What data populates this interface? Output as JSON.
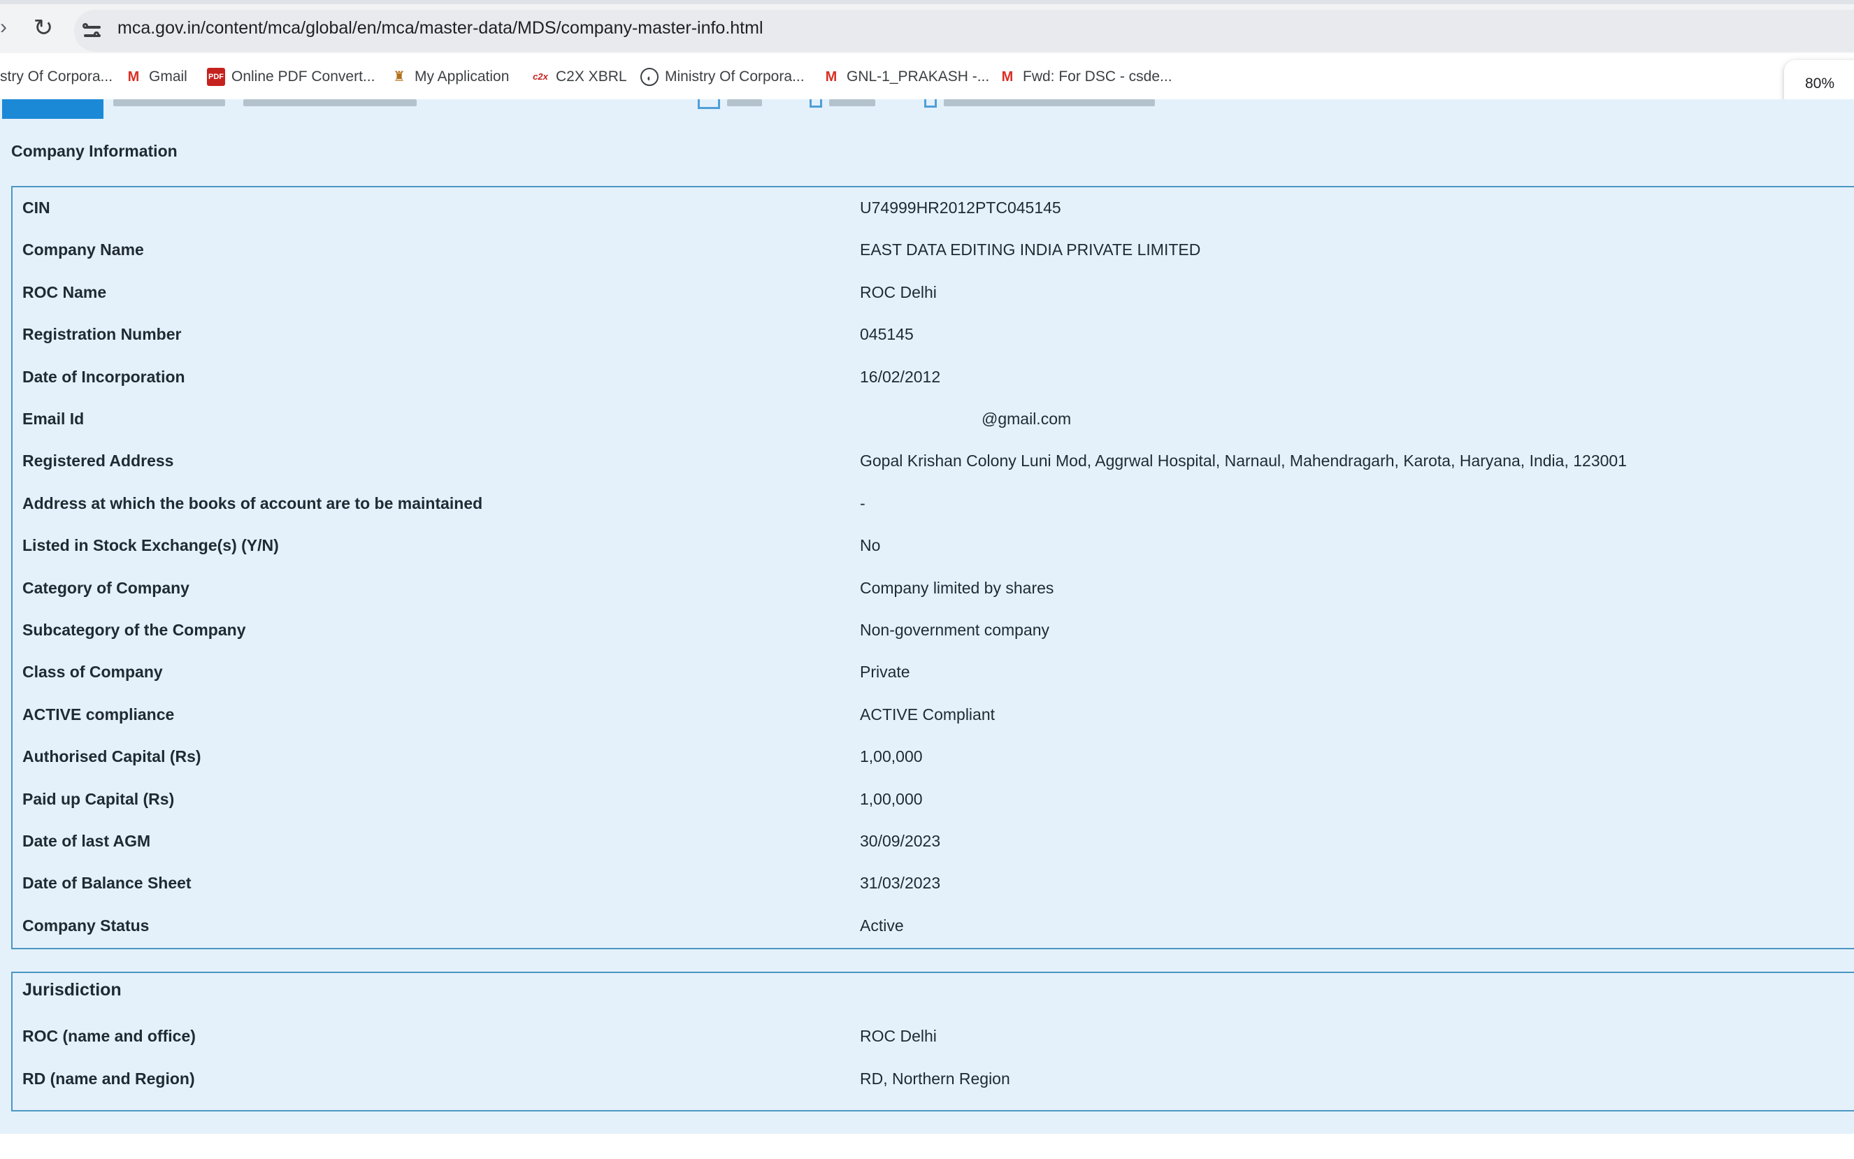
{
  "browser": {
    "url": "mca.gov.in/content/mca/global/en/mca/master-data/MDS/company-master-info.html",
    "zoom": "80%",
    "bookmarks": [
      {
        "label": "stry Of Corpora...",
        "icon": ""
      },
      {
        "label": "Gmail",
        "icon": "gmail-icon"
      },
      {
        "label": "Online PDF Convert...",
        "icon": "pdf-icon"
      },
      {
        "label": "My Application",
        "icon": "application-icon"
      },
      {
        "label": "C2X XBRL",
        "icon": "c2x-icon"
      },
      {
        "label": "Ministry Of Corpora...",
        "icon": "globe-icon"
      },
      {
        "label": "GNL-1_PRAKASH -...",
        "icon": "gmail-icon"
      },
      {
        "label": "Fwd: For DSC - csde...",
        "icon": "gmail-icon"
      }
    ]
  },
  "company_info": {
    "title": "Company Information",
    "rows": [
      {
        "label": "CIN",
        "value": "U74999HR2012PTC045145"
      },
      {
        "label": "Company Name",
        "value": "EAST DATA EDITING INDIA PRIVATE LIMITED"
      },
      {
        "label": "ROC Name",
        "value": "ROC Delhi"
      },
      {
        "label": "Registration Number",
        "value": "045145"
      },
      {
        "label": "Date of Incorporation",
        "value": "16/02/2012"
      },
      {
        "label": "Email Id",
        "value": "@gmail.com"
      },
      {
        "label": "Registered Address",
        "value": "Gopal Krishan Colony Luni Mod, Aggrwal Hospital, Narnaul, Mahendragarh, Karota, Haryana, India, 123001"
      },
      {
        "label": "Address at which the books of account are to be maintained",
        "value": "-"
      },
      {
        "label": "Listed in Stock Exchange(s) (Y/N)",
        "value": "No"
      },
      {
        "label": "Category of Company",
        "value": "Company limited by shares"
      },
      {
        "label": "Subcategory of the Company",
        "value": "Non-government company"
      },
      {
        "label": "Class of Company",
        "value": "Private"
      },
      {
        "label": "ACTIVE compliance",
        "value": "ACTIVE Compliant"
      },
      {
        "label": "Authorised Capital (Rs)",
        "value": "1,00,000"
      },
      {
        "label": "Paid up Capital (Rs)",
        "value": "1,00,000"
      },
      {
        "label": "Date of last AGM",
        "value": "30/09/2023"
      },
      {
        "label": "Date of Balance Sheet",
        "value": "31/03/2023"
      },
      {
        "label": "Company Status",
        "value": "Active"
      }
    ]
  },
  "jurisdiction": {
    "title": "Jurisdiction",
    "rows": [
      {
        "label": "ROC (name and office)",
        "value": "ROC Delhi"
      },
      {
        "label": "RD (name and Region)",
        "value": "RD, Northern Region"
      }
    ]
  }
}
